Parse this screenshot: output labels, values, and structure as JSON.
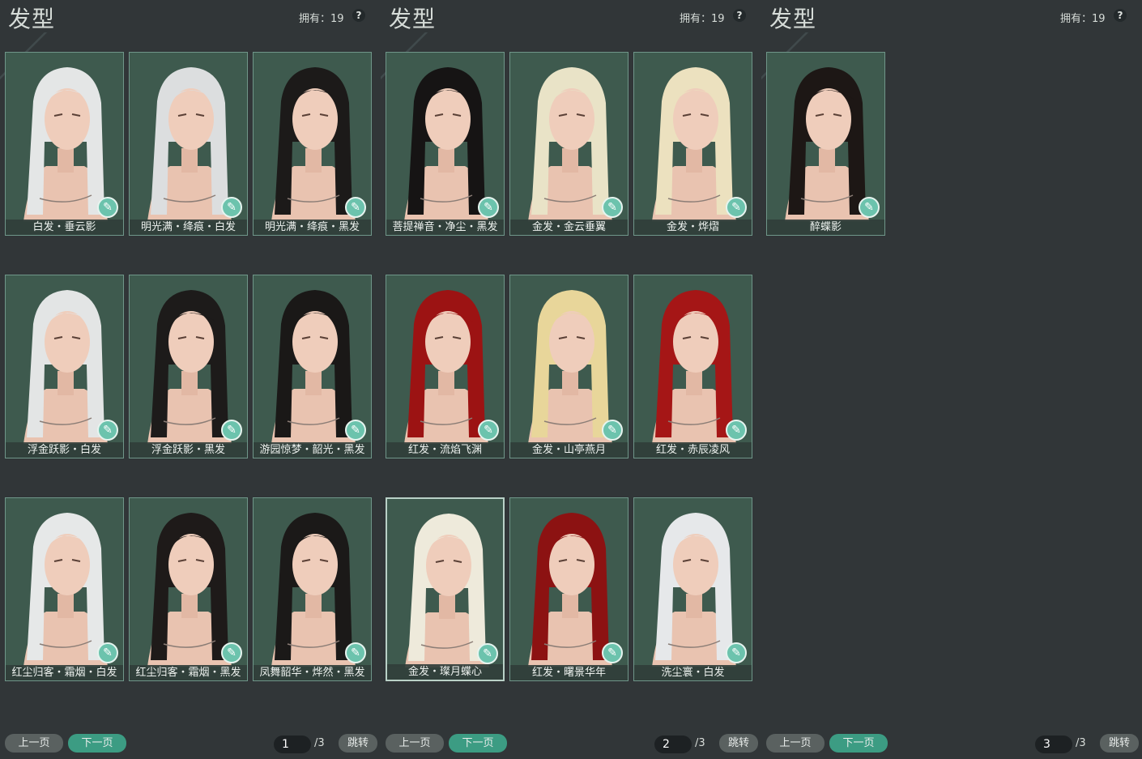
{
  "panels": [
    {
      "title": "发型",
      "owned": "拥有：19",
      "help": "?",
      "cards": [
        {
          "name": "白发・垂云影",
          "hair": "#e4e6e6"
        },
        {
          "name": "明光满・绛痕・白发",
          "hair": "#dcdedf"
        },
        {
          "name": "明光满・绛痕・黑发",
          "hair": "#1c1a19"
        },
        {
          "name": "浮金跃影・白发",
          "hair": "#e3e5e5"
        },
        {
          "name": "浮金跃影・黑发",
          "hair": "#1d1b1a"
        },
        {
          "name": "游园惊梦・韶光・黑发",
          "hair": "#1a1817"
        },
        {
          "name": "红尘归客・霜烟・白发",
          "hair": "#e6e8e8"
        },
        {
          "name": "红尘归客・霜烟・黑发",
          "hair": "#1e1a19"
        },
        {
          "name": "凤舞韶华・烨然・黑发",
          "hair": "#1b1918"
        }
      ],
      "pager": {
        "prev": "上一页",
        "next": "下一页",
        "page": "1",
        "total": "/3",
        "jump": "跳转"
      }
    },
    {
      "title": "发型",
      "owned": "拥有：19",
      "help": "?",
      "cards": [
        {
          "name": "菩提禅音・净尘・黑发",
          "hair": "#161414"
        },
        {
          "name": "金发・金云垂翼",
          "hair": "#e9e3c7"
        },
        {
          "name": "金发・烨熠",
          "hair": "#ece1bf"
        },
        {
          "name": "红发・流焰飞渊",
          "hair": "#9c1313"
        },
        {
          "name": "金发・山亭燕月",
          "hair": "#e8d69a"
        },
        {
          "name": "红发・赤辰凌风",
          "hair": "#a51616"
        },
        {
          "name": "金发・璨月蝶心",
          "hair": "#eeeadb"
        },
        {
          "name": "红发・曙景华年",
          "hair": "#8c1212"
        },
        {
          "name": "洗尘寰・白发",
          "hair": "#e6e8ea"
        }
      ],
      "pager": {
        "prev": "上一页",
        "next": "下一页",
        "page": "2",
        "total": "/3",
        "jump": "跳转"
      }
    },
    {
      "title": "发型",
      "owned": "拥有：19",
      "help": "?",
      "cards": [
        {
          "name": "醉蝶影",
          "hair": "#1d1715"
        }
      ],
      "pager": {
        "prev": "上一页",
        "next": "下一页",
        "page": "3",
        "total": "/3",
        "jump": "跳转"
      }
    }
  ],
  "selected_card": "金发・璨月蝶心",
  "colors": {
    "background": "#313638",
    "card": "#3f5a4f",
    "accent": "#3c9c83",
    "dye_icon": "#6cc3ad"
  },
  "icons": {
    "dye": "paint-brush-icon",
    "help": "question-icon"
  }
}
